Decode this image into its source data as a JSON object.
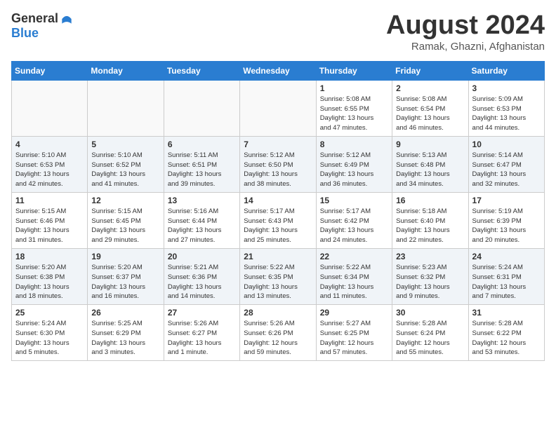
{
  "header": {
    "logo_general": "General",
    "logo_blue": "Blue",
    "month_title": "August 2024",
    "location": "Ramak, Ghazni, Afghanistan"
  },
  "weekdays": [
    "Sunday",
    "Monday",
    "Tuesday",
    "Wednesday",
    "Thursday",
    "Friday",
    "Saturday"
  ],
  "weeks": [
    [
      {
        "day": "",
        "info": ""
      },
      {
        "day": "",
        "info": ""
      },
      {
        "day": "",
        "info": ""
      },
      {
        "day": "",
        "info": ""
      },
      {
        "day": "1",
        "info": "Sunrise: 5:08 AM\nSunset: 6:55 PM\nDaylight: 13 hours\nand 47 minutes."
      },
      {
        "day": "2",
        "info": "Sunrise: 5:08 AM\nSunset: 6:54 PM\nDaylight: 13 hours\nand 46 minutes."
      },
      {
        "day": "3",
        "info": "Sunrise: 5:09 AM\nSunset: 6:53 PM\nDaylight: 13 hours\nand 44 minutes."
      }
    ],
    [
      {
        "day": "4",
        "info": "Sunrise: 5:10 AM\nSunset: 6:53 PM\nDaylight: 13 hours\nand 42 minutes."
      },
      {
        "day": "5",
        "info": "Sunrise: 5:10 AM\nSunset: 6:52 PM\nDaylight: 13 hours\nand 41 minutes."
      },
      {
        "day": "6",
        "info": "Sunrise: 5:11 AM\nSunset: 6:51 PM\nDaylight: 13 hours\nand 39 minutes."
      },
      {
        "day": "7",
        "info": "Sunrise: 5:12 AM\nSunset: 6:50 PM\nDaylight: 13 hours\nand 38 minutes."
      },
      {
        "day": "8",
        "info": "Sunrise: 5:12 AM\nSunset: 6:49 PM\nDaylight: 13 hours\nand 36 minutes."
      },
      {
        "day": "9",
        "info": "Sunrise: 5:13 AM\nSunset: 6:48 PM\nDaylight: 13 hours\nand 34 minutes."
      },
      {
        "day": "10",
        "info": "Sunrise: 5:14 AM\nSunset: 6:47 PM\nDaylight: 13 hours\nand 32 minutes."
      }
    ],
    [
      {
        "day": "11",
        "info": "Sunrise: 5:15 AM\nSunset: 6:46 PM\nDaylight: 13 hours\nand 31 minutes."
      },
      {
        "day": "12",
        "info": "Sunrise: 5:15 AM\nSunset: 6:45 PM\nDaylight: 13 hours\nand 29 minutes."
      },
      {
        "day": "13",
        "info": "Sunrise: 5:16 AM\nSunset: 6:44 PM\nDaylight: 13 hours\nand 27 minutes."
      },
      {
        "day": "14",
        "info": "Sunrise: 5:17 AM\nSunset: 6:43 PM\nDaylight: 13 hours\nand 25 minutes."
      },
      {
        "day": "15",
        "info": "Sunrise: 5:17 AM\nSunset: 6:42 PM\nDaylight: 13 hours\nand 24 minutes."
      },
      {
        "day": "16",
        "info": "Sunrise: 5:18 AM\nSunset: 6:40 PM\nDaylight: 13 hours\nand 22 minutes."
      },
      {
        "day": "17",
        "info": "Sunrise: 5:19 AM\nSunset: 6:39 PM\nDaylight: 13 hours\nand 20 minutes."
      }
    ],
    [
      {
        "day": "18",
        "info": "Sunrise: 5:20 AM\nSunset: 6:38 PM\nDaylight: 13 hours\nand 18 minutes."
      },
      {
        "day": "19",
        "info": "Sunrise: 5:20 AM\nSunset: 6:37 PM\nDaylight: 13 hours\nand 16 minutes."
      },
      {
        "day": "20",
        "info": "Sunrise: 5:21 AM\nSunset: 6:36 PM\nDaylight: 13 hours\nand 14 minutes."
      },
      {
        "day": "21",
        "info": "Sunrise: 5:22 AM\nSunset: 6:35 PM\nDaylight: 13 hours\nand 13 minutes."
      },
      {
        "day": "22",
        "info": "Sunrise: 5:22 AM\nSunset: 6:34 PM\nDaylight: 13 hours\nand 11 minutes."
      },
      {
        "day": "23",
        "info": "Sunrise: 5:23 AM\nSunset: 6:32 PM\nDaylight: 13 hours\nand 9 minutes."
      },
      {
        "day": "24",
        "info": "Sunrise: 5:24 AM\nSunset: 6:31 PM\nDaylight: 13 hours\nand 7 minutes."
      }
    ],
    [
      {
        "day": "25",
        "info": "Sunrise: 5:24 AM\nSunset: 6:30 PM\nDaylight: 13 hours\nand 5 minutes."
      },
      {
        "day": "26",
        "info": "Sunrise: 5:25 AM\nSunset: 6:29 PM\nDaylight: 13 hours\nand 3 minutes."
      },
      {
        "day": "27",
        "info": "Sunrise: 5:26 AM\nSunset: 6:27 PM\nDaylight: 13 hours\nand 1 minute."
      },
      {
        "day": "28",
        "info": "Sunrise: 5:26 AM\nSunset: 6:26 PM\nDaylight: 12 hours\nand 59 minutes."
      },
      {
        "day": "29",
        "info": "Sunrise: 5:27 AM\nSunset: 6:25 PM\nDaylight: 12 hours\nand 57 minutes."
      },
      {
        "day": "30",
        "info": "Sunrise: 5:28 AM\nSunset: 6:24 PM\nDaylight: 12 hours\nand 55 minutes."
      },
      {
        "day": "31",
        "info": "Sunrise: 5:28 AM\nSunset: 6:22 PM\nDaylight: 12 hours\nand 53 minutes."
      }
    ]
  ]
}
